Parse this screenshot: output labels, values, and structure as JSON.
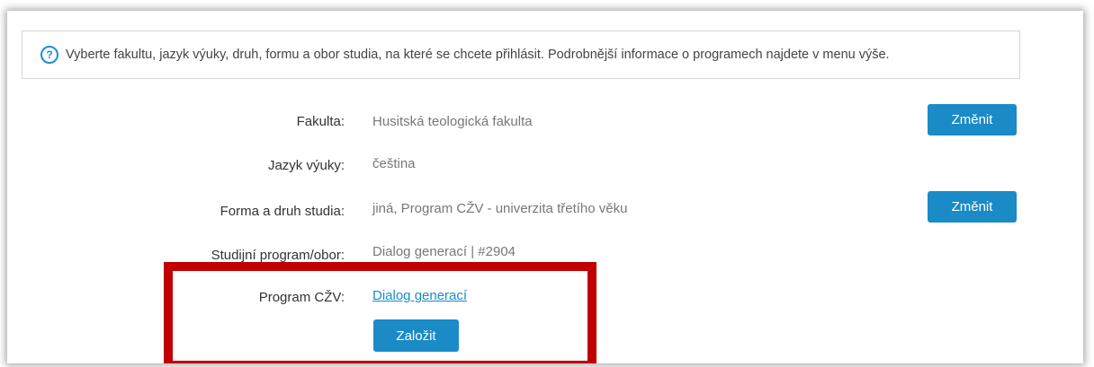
{
  "info": {
    "text": "Vyberte fakultu, jazyk výuky, druh, formu a obor studia, na které se chcete přihlásit. Podrobnější informace o programech najdete v menu výše."
  },
  "rows": {
    "faculty": {
      "label": "Fakulta:",
      "value": "Husitská teologická fakulta",
      "button": "Změnit"
    },
    "language": {
      "label": "Jazyk výuky:",
      "value": "čeština"
    },
    "form": {
      "label": "Forma a druh studia:",
      "value": "jiná, Program CŽV - univerzita třetího věku",
      "button": "Změnit"
    },
    "program": {
      "label": "Studijní program/obor:",
      "value": "Dialog generací | #2904"
    },
    "czv": {
      "label": "Program CŽV:",
      "link": "Dialog generací",
      "button": "Založit"
    }
  },
  "colors": {
    "accent": "#1a8bc7",
    "highlight": "#c00000"
  },
  "icons": {
    "info": "question-circle-icon"
  }
}
